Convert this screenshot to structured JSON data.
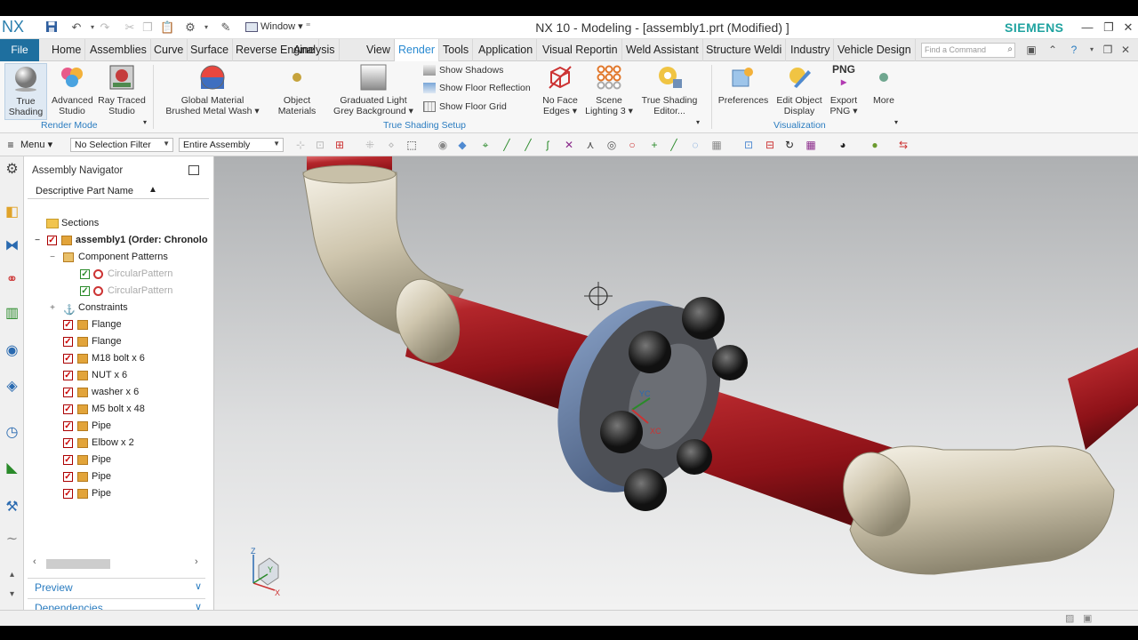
{
  "titlebar": {
    "logo": "NX",
    "window_menu": "Window",
    "title": "NX 10 - Modeling - [assembly1.prt (Modified) ]",
    "brand": "SIEMENS"
  },
  "tabs": {
    "file": "File",
    "items": [
      "Home",
      "Assemblies",
      "Curve",
      "Surface",
      "Reverse Engine",
      "Analysis",
      "View",
      "Render",
      "Tools",
      "Application",
      "Visual Reportin",
      "Weld Assistant",
      "Structure Weldi",
      "Industry",
      "Vehicle Design"
    ],
    "active": "Render",
    "find_placeholder": "Find a Command"
  },
  "ribbon": {
    "true_shading": "True Shading",
    "advanced_studio": "Advanced Studio",
    "ray_traced_studio": "Ray Traced Studio",
    "global_material": "Global Material",
    "global_material_value": "Brushed Metal Wash",
    "object_materials": "Object Materials",
    "graduated_light": "Graduated Light",
    "graduated_light_value": "Grey Background",
    "show_shadows": "Show Shadows",
    "show_floor_reflection": "Show Floor Reflection",
    "show_floor_grid": "Show Floor Grid",
    "no_face_edges": "No Face Edges",
    "scene_lighting": "Scene Lighting 3",
    "true_shading_editor": "True Shading Editor...",
    "preferences": "Preferences",
    "edit_object_display": "Edit Object Display",
    "export_png": "Export PNG",
    "png_label": "PNG",
    "more": "More",
    "group_render_mode": "Render Mode",
    "group_true_shading_setup": "True Shading Setup",
    "group_visualization": "Visualization"
  },
  "selection_bar": {
    "menu": "Menu",
    "selection_filter": "No Selection Filter",
    "scope": "Entire Assembly"
  },
  "navigator": {
    "title": "Assembly Navigator",
    "column": "Descriptive Part Name",
    "sections": "Sections",
    "root": "assembly1 (Order: Chronolo",
    "component_patterns": "Component Patterns",
    "pattern1": "CircularPattern",
    "pattern2": "CircularPattern",
    "constraints": "Constraints",
    "parts": [
      "Flange",
      "Flange",
      "M18 bolt x 6",
      "NUT x 6",
      "washer x 6",
      "M5 bolt x 48",
      "Pipe",
      "Elbow x 2",
      "Pipe",
      "Pipe",
      "Pipe"
    ],
    "preview": "Preview",
    "dependencies": "Dependencies"
  },
  "viewport": {
    "wcs_x": "X",
    "wcs_y": "Y",
    "wcs_z": "Z",
    "csys_xc": "XC",
    "csys_yc": "YC"
  },
  "colors": {
    "accent": "#2a8ad1",
    "file_tab": "#1e6f9f",
    "brand": "#20a3a0",
    "pipe_red": "#a3161c",
    "fitting_cream": "#d6cdb7"
  }
}
